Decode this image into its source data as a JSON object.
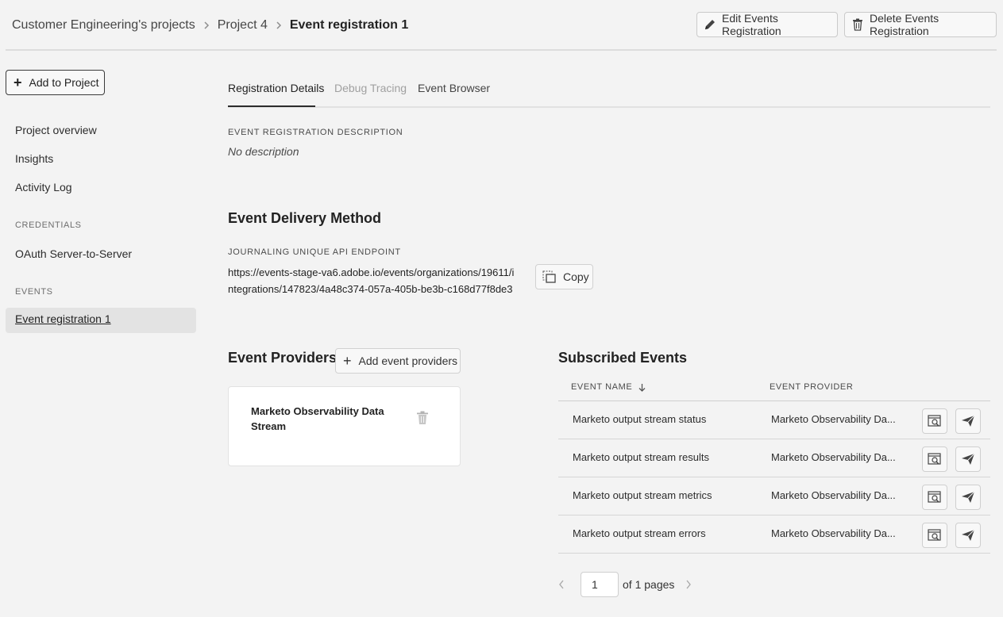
{
  "breadcrumb": {
    "items": [
      "Customer Engineering's projects",
      "Project 4"
    ],
    "current": "Event registration 1"
  },
  "header": {
    "edit_label": "Edit Events Registration",
    "delete_label": "Delete Events Registration"
  },
  "sidebar": {
    "add_project_label": "Add to Project",
    "items": [
      "Project overview",
      "Insights",
      "Activity Log"
    ],
    "credentials_heading": "CREDENTIALS",
    "credentials_items": [
      "OAuth Server-to-Server"
    ],
    "events_heading": "EVENTS",
    "events_items": [
      "Event registration 1"
    ]
  },
  "tabs": [
    "Registration Details",
    "Debug Tracing",
    "Event Browser"
  ],
  "details": {
    "description_label": "EVENT REGISTRATION DESCRIPTION",
    "description_value": "No description",
    "delivery_title": "Event Delivery Method",
    "endpoint_label": "JOURNALING UNIQUE API ENDPOINT",
    "endpoint_value": "https://events-stage-va6.adobe.io/events/organizations/19611/integrations/147823/4a48c374-057a-405b-be3b-c168d77f8de3",
    "copy_label": "Copy"
  },
  "providers": {
    "title": "Event Providers",
    "add_label": "Add event providers",
    "cards": [
      {
        "name": "Marketo Observability Data Stream"
      }
    ]
  },
  "subscribed": {
    "title": "Subscribed Events",
    "col_name": "EVENT NAME",
    "col_provider": "EVENT PROVIDER",
    "rows": [
      {
        "name": "Marketo output stream status",
        "provider": "Marketo Observability Da..."
      },
      {
        "name": "Marketo output stream results",
        "provider": "Marketo Observability Da..."
      },
      {
        "name": "Marketo output stream metrics",
        "provider": "Marketo Observability Da..."
      },
      {
        "name": "Marketo output stream errors",
        "provider": "Marketo Observability Da..."
      }
    ]
  },
  "pagination": {
    "page": "1",
    "of_text": "of 1 pages"
  }
}
